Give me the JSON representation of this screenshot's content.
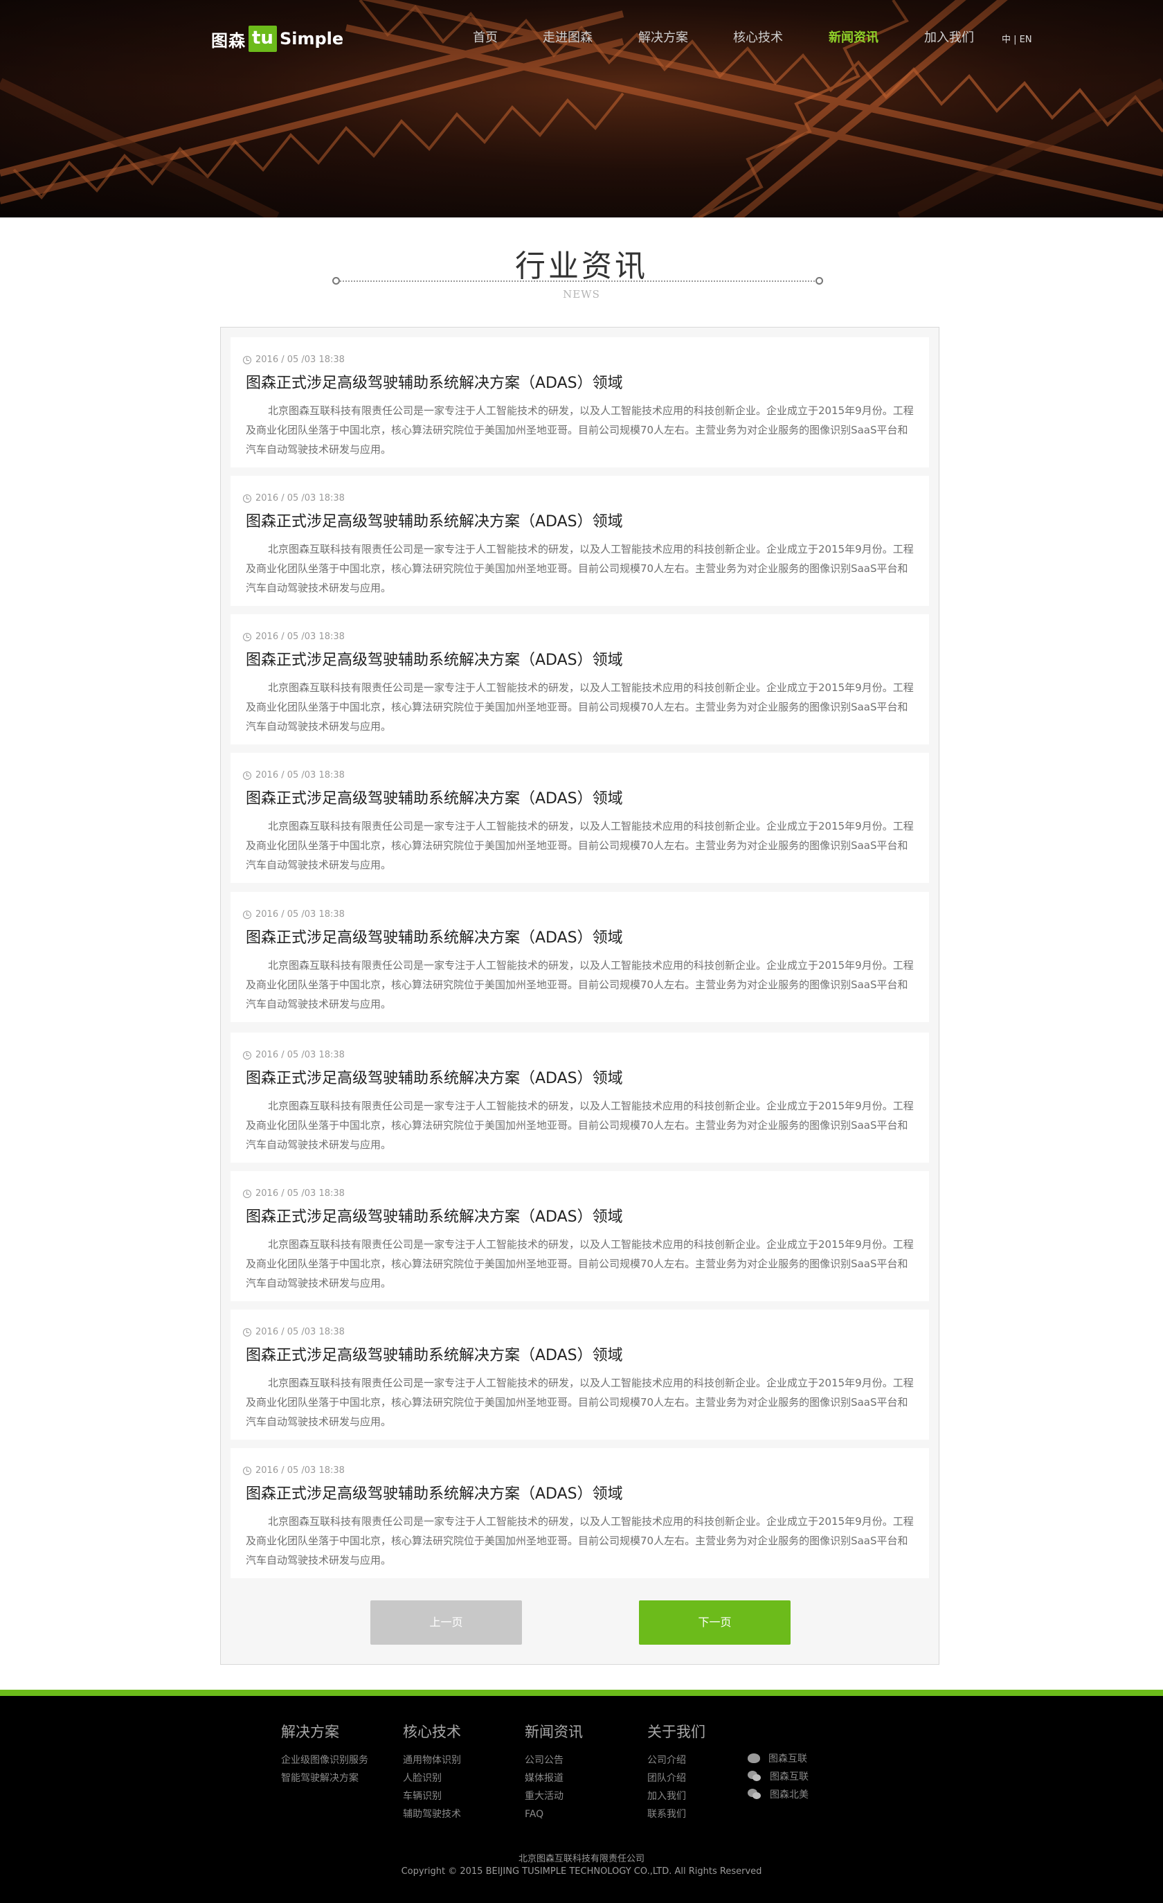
{
  "brand": {
    "logo_cn": "图森",
    "logo_tu": "tu",
    "logo_en": "Simple"
  },
  "nav": {
    "items": [
      {
        "label": "首页",
        "active": false
      },
      {
        "label": "走进图森",
        "active": false
      },
      {
        "label": "解决方案",
        "active": false
      },
      {
        "label": "核心技术",
        "active": false
      },
      {
        "label": "新闻资讯",
        "active": true
      },
      {
        "label": "加入我们",
        "active": false
      }
    ],
    "lang": "中 | EN"
  },
  "section": {
    "title": "行业资讯",
    "subtitle": "NEWS"
  },
  "news": [
    {
      "date": "2016 / 05 /03 18:38",
      "title": "图森正式涉足高级驾驶辅助系统解决方案（ADAS）领域",
      "body": "北京图森互联科技有限责任公司是一家专注于人工智能技术的研发，以及人工智能技术应用的科技创新企业。企业成立于2015年9月份。工程及商业化团队坐落于中国北京，核心算法研究院位于美国加州圣地亚哥。目前公司规模70人左右。主营业务为对企业服务的图像识别SaaS平台和汽车自动驾驶技术研发与应用。"
    },
    {
      "date": "2016 / 05 /03 18:38",
      "title": "图森正式涉足高级驾驶辅助系统解决方案（ADAS）领域",
      "body": "北京图森互联科技有限责任公司是一家专注于人工智能技术的研发，以及人工智能技术应用的科技创新企业。企业成立于2015年9月份。工程及商业化团队坐落于中国北京，核心算法研究院位于美国加州圣地亚哥。目前公司规模70人左右。主营业务为对企业服务的图像识别SaaS平台和汽车自动驾驶技术研发与应用。"
    },
    {
      "date": "2016 / 05 /03 18:38",
      "title": "图森正式涉足高级驾驶辅助系统解决方案（ADAS）领域",
      "body": "北京图森互联科技有限责任公司是一家专注于人工智能技术的研发，以及人工智能技术应用的科技创新企业。企业成立于2015年9月份。工程及商业化团队坐落于中国北京，核心算法研究院位于美国加州圣地亚哥。目前公司规模70人左右。主营业务为对企业服务的图像识别SaaS平台和汽车自动驾驶技术研发与应用。"
    },
    {
      "date": "2016 / 05 /03 18:38",
      "title": "图森正式涉足高级驾驶辅助系统解决方案（ADAS）领域",
      "body": "北京图森互联科技有限责任公司是一家专注于人工智能技术的研发，以及人工智能技术应用的科技创新企业。企业成立于2015年9月份。工程及商业化团队坐落于中国北京，核心算法研究院位于美国加州圣地亚哥。目前公司规模70人左右。主营业务为对企业服务的图像识别SaaS平台和汽车自动驾驶技术研发与应用。"
    },
    {
      "date": "2016 / 05 /03 18:38",
      "title": "图森正式涉足高级驾驶辅助系统解决方案（ADAS）领域",
      "body": "北京图森互联科技有限责任公司是一家专注于人工智能技术的研发，以及人工智能技术应用的科技创新企业。企业成立于2015年9月份。工程及商业化团队坐落于中国北京，核心算法研究院位于美国加州圣地亚哥。目前公司规模70人左右。主营业务为对企业服务的图像识别SaaS平台和汽车自动驾驶技术研发与应用。"
    },
    {
      "date": "2016 / 05 /03 18:38",
      "title": "图森正式涉足高级驾驶辅助系统解决方案（ADAS）领域",
      "body": "北京图森互联科技有限责任公司是一家专注于人工智能技术的研发，以及人工智能技术应用的科技创新企业。企业成立于2015年9月份。工程及商业化团队坐落于中国北京，核心算法研究院位于美国加州圣地亚哥。目前公司规模70人左右。主营业务为对企业服务的图像识别SaaS平台和汽车自动驾驶技术研发与应用。"
    },
    {
      "date": "2016 / 05 /03 18:38",
      "title": "图森正式涉足高级驾驶辅助系统解决方案（ADAS）领域",
      "body": "北京图森互联科技有限责任公司是一家专注于人工智能技术的研发，以及人工智能技术应用的科技创新企业。企业成立于2015年9月份。工程及商业化团队坐落于中国北京，核心算法研究院位于美国加州圣地亚哥。目前公司规模70人左右。主营业务为对企业服务的图像识别SaaS平台和汽车自动驾驶技术研发与应用。"
    },
    {
      "date": "2016 / 05 /03 18:38",
      "title": "图森正式涉足高级驾驶辅助系统解决方案（ADAS）领域",
      "body": "北京图森互联科技有限责任公司是一家专注于人工智能技术的研发，以及人工智能技术应用的科技创新企业。企业成立于2015年9月份。工程及商业化团队坐落于中国北京，核心算法研究院位于美国加州圣地亚哥。目前公司规模70人左右。主营业务为对企业服务的图像识别SaaS平台和汽车自动驾驶技术研发与应用。"
    },
    {
      "date": "2016 / 05 /03 18:38",
      "title": "图森正式涉足高级驾驶辅助系统解决方案（ADAS）领域",
      "body": "北京图森互联科技有限责任公司是一家专注于人工智能技术的研发，以及人工智能技术应用的科技创新企业。企业成立于2015年9月份。工程及商业化团队坐落于中国北京，核心算法研究院位于美国加州圣地亚哥。目前公司规模70人左右。主营业务为对企业服务的图像识别SaaS平台和汽车自动驾驶技术研发与应用。"
    }
  ],
  "pagination": {
    "prev_label": "上一页",
    "next_label": "下一页"
  },
  "footer": {
    "columns": [
      {
        "heading": "解决方案",
        "links": [
          "企业级图像识别服务",
          "智能驾驶解决方案"
        ]
      },
      {
        "heading": "核心技术",
        "links": [
          "通用物体识别",
          "人脸识别",
          "车辆识别",
          "辅助驾驶技术"
        ]
      },
      {
        "heading": "新闻资讯",
        "links": [
          "公司公告",
          "媒体报道",
          "重大活动",
          "FAQ"
        ]
      },
      {
        "heading": "关于我们",
        "links": [
          "公司介绍",
          "团队介绍",
          "加入我们",
          "联系我们"
        ]
      }
    ],
    "social": [
      {
        "icon": "weibo-icon",
        "label": "图森互联"
      },
      {
        "icon": "wechat-icon",
        "label": "图森互联"
      },
      {
        "icon": "wechat-icon",
        "label": "图森北美"
      }
    ],
    "company": "北京图森互联科技有限责任公司",
    "copyright": "Copyright © 2015 BEIJING TUSIMPLE TECHNOLOGY CO.,LTD. All Rights Reserved"
  },
  "colors": {
    "accent": "#6cbb1b",
    "nav_active": "#8fd12a",
    "footer_bg": "#000000",
    "panel_bg": "#f6f6f6"
  }
}
